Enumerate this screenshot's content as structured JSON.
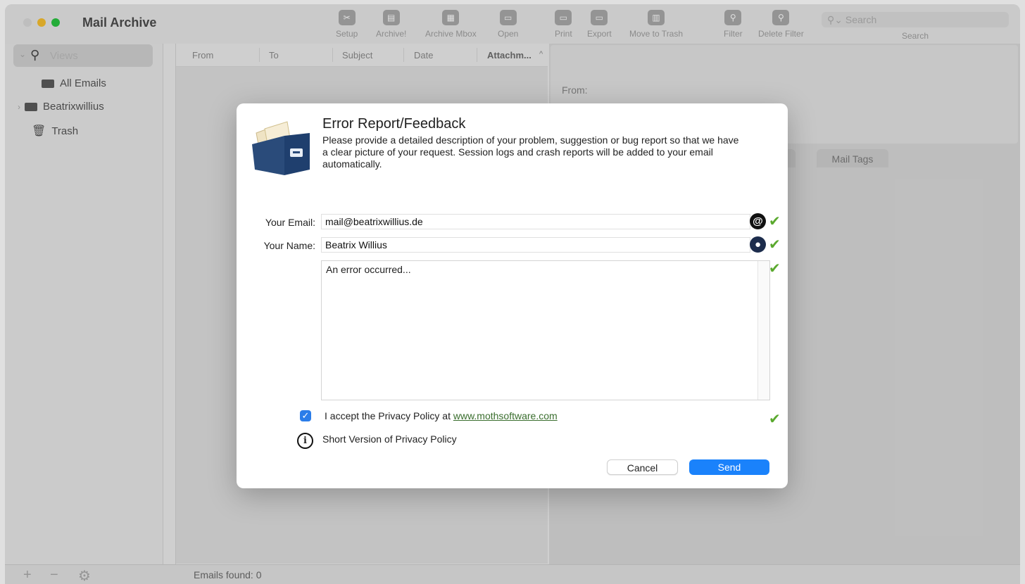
{
  "window": {
    "title": "Mail Archive",
    "traffic_lights": [
      "close",
      "minimize",
      "maximize"
    ]
  },
  "toolbar": {
    "buttons": [
      {
        "label": "Setup",
        "icon": "tools-icon"
      },
      {
        "label": "Archive!",
        "icon": "archive-icon"
      },
      {
        "label": "Archive Mbox",
        "icon": "mbox-icon"
      },
      {
        "label": "Open",
        "icon": "folder-open-icon"
      },
      {
        "label": "Print",
        "icon": "print-icon"
      },
      {
        "label": "Export",
        "icon": "export-icon"
      },
      {
        "label": "Move to Trash",
        "icon": "trash-icon"
      },
      {
        "label": "Filter",
        "icon": "filter-icon"
      },
      {
        "label": "Delete Filter",
        "icon": "delete-filter-icon"
      }
    ],
    "search_placeholder": "Search",
    "search_label": "Search"
  },
  "sidebar": {
    "views_label": "Views",
    "items": [
      {
        "label": "All Emails",
        "icon": "folder-icon"
      },
      {
        "label": "Beatrixwillius",
        "icon": "folder-icon"
      },
      {
        "label": "Trash",
        "icon": "trash-icon"
      }
    ]
  },
  "email_list": {
    "columns": [
      "From",
      "To",
      "Subject",
      "Date",
      "Attachm..."
    ]
  },
  "detail": {
    "from_label": "From:",
    "tabs": [
      "Mail Tags"
    ]
  },
  "statusbar": {
    "emails_found": "Emails found: 0"
  },
  "dialog": {
    "title": "Error Report/Feedback",
    "description": "Please provide a detailed description of your problem, suggestion or bug report so that we have a clear picture of your request. Session logs and crash reports will be added to your email automatically.",
    "email_label": "Your Email:",
    "email_value": "mail@beatrixwillius.de",
    "name_label": "Your Name:",
    "name_value": "Beatrix Willius",
    "message_value": "An error occurred...",
    "privacy_accept_text": "I accept the Privacy Policy at ",
    "privacy_link": "www.mothsoftware.com",
    "privacy_checked": true,
    "short_policy": "Short Version of Privacy Policy",
    "cancel_label": "Cancel",
    "send_label": "Send",
    "accent_color": "#1a82fb",
    "check_color": "#5aa92e"
  }
}
